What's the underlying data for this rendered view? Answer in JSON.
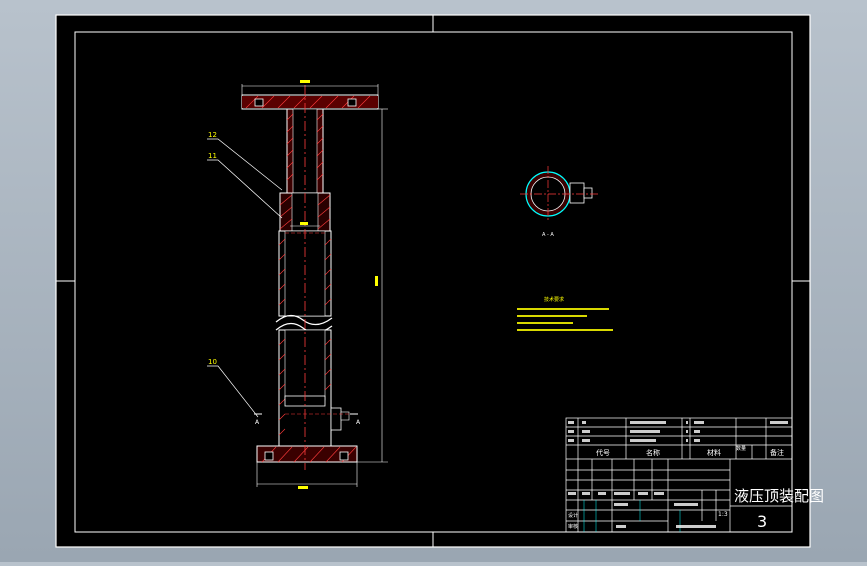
{
  "drawing": {
    "colors": {
      "background": "#000000",
      "frame": "#ffffff",
      "hatch": "#ff3b3b",
      "dimension": "#ffff00",
      "part_lines": "#ffffff",
      "notes": "#ffff00",
      "section_outline": "#00ffff"
    },
    "leader_labels": [
      "12",
      "11",
      "10"
    ],
    "section_label": "A - A",
    "section_marks": [
      "A",
      "A"
    ],
    "tech_notes_title": "技术要求",
    "title_block": {
      "drawing_title": "液压顶装配图",
      "scale": "1:3",
      "sheet_number": "3",
      "header_labels": [
        "代号",
        "名称",
        "材料",
        "备注"
      ],
      "labels": [
        "数量",
        "设计",
        "审核"
      ]
    }
  }
}
